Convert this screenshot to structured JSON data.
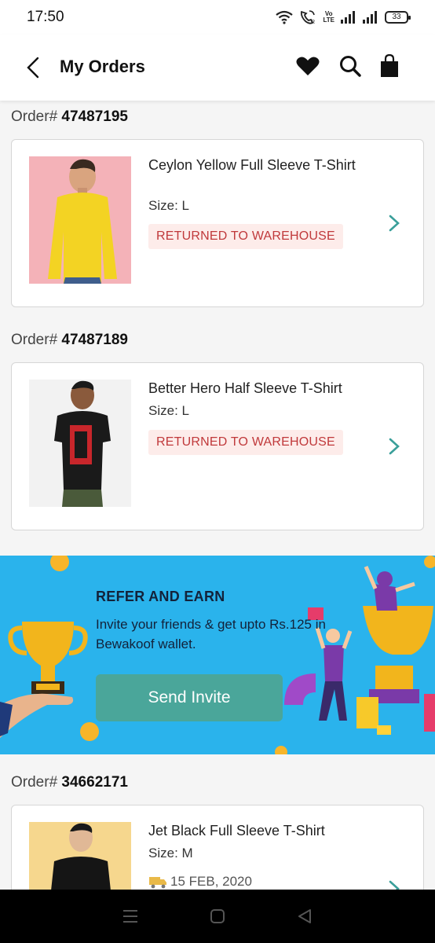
{
  "status_bar": {
    "time": "17:50",
    "battery": "33",
    "volte_top": "Vo",
    "volte_bottom": "LTE",
    "icons": [
      "wifi-icon",
      "wifi-calling-icon",
      "volte-icon",
      "signal-icon",
      "signal-icon",
      "battery-icon"
    ]
  },
  "header": {
    "title": "My Orders",
    "icons": [
      "back-arrow-icon",
      "heart-icon",
      "search-icon",
      "shopping-bag-icon"
    ]
  },
  "orders": [
    {
      "label": "Order#",
      "number": "47487195",
      "product_name": "Ceylon Yellow Full Sleeve T-Shirt",
      "size": "Size: L",
      "status": "RETURNED TO WAREHOUSE",
      "image_bg": "#f4b2b8",
      "shirt_color": "#f3d323"
    },
    {
      "label": "Order#",
      "number": "47487189",
      "product_name": "Better Hero Half Sleeve T-Shirt",
      "size": "Size: L",
      "status": "RETURNED TO WAREHOUSE",
      "image_bg": "#f2f2f2",
      "shirt_color": "#1a1a1a"
    },
    {
      "label": "Order#",
      "number": "34662171",
      "product_name": "Jet Black Full Sleeve T-Shirt",
      "size": "Size: M",
      "date": "15 FEB, 2020",
      "image_bg": "#f6d78e",
      "shirt_color": "#151515"
    }
  ],
  "refer": {
    "title": "REFER AND EARN",
    "description": "Invite your friends & get upto Rs.125 in Bewakoof wallet.",
    "button": "Send Invite"
  },
  "colors": {
    "accent_teal": "#4aa69a",
    "chevron": "#3a9f9a",
    "status_text": "#c0393b",
    "status_bg": "#fdecea",
    "banner_bg": "#2ab3ec"
  },
  "nav_bar": {
    "icons": [
      "menu-icon",
      "home-icon",
      "back-icon"
    ]
  }
}
